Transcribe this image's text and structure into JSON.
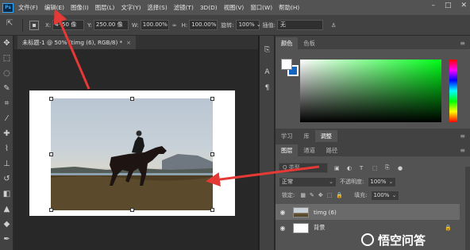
{
  "app": {
    "logo_text": "Ps"
  },
  "menu": [
    "文件(F)",
    "编辑(E)",
    "图像(I)",
    "图层(L)",
    "文字(Y)",
    "选择(S)",
    "滤镜(T)",
    "3D(D)",
    "视图(V)",
    "窗口(W)",
    "帮助(H)"
  ],
  "window_controls": {
    "minimize": "–",
    "maximize": "□",
    "close": "✕"
  },
  "options": {
    "x_label": "X:",
    "x_value": "4··50 像",
    "y_label": "Y:",
    "y_value": "250.00 像",
    "w_label": "W:",
    "w_value": "100.00%",
    "link_label": "∞",
    "h_label": "H:",
    "h_value": "100.00%",
    "angle_label": "旋转:",
    "angle_value": "100% ⌄",
    "interp_label": "插值:",
    "interp_value": "无"
  },
  "document_tab": {
    "title": "未标题-1 @ 50% (timg (6), RGB/8) *",
    "close": "×"
  },
  "color_panel": {
    "tabs": [
      "颜色",
      "色板"
    ]
  },
  "learn_panel": {
    "tabs": [
      "学习",
      "库",
      "调整"
    ]
  },
  "layers_panel": {
    "tabs": [
      "图层",
      "通道",
      "路径"
    ],
    "search_placeholder": "Q 类型",
    "blend_mode": "正常",
    "opacity_label": "不透明度:",
    "opacity_value": "100%",
    "lock_label": "锁定:",
    "fill_label": "填充:",
    "fill_value": "100%",
    "layers": [
      {
        "name": "timg (6)",
        "visible": true,
        "selected": true,
        "locked": false
      },
      {
        "name": "背景",
        "visible": true,
        "selected": false,
        "locked": true
      }
    ]
  },
  "watermark": {
    "text": "悟空问答"
  },
  "colors": {
    "accent": "#31a8ff",
    "arrow": "#e53935",
    "background_swatch": "#1565c0",
    "foreground_swatch": "#ffffff"
  }
}
